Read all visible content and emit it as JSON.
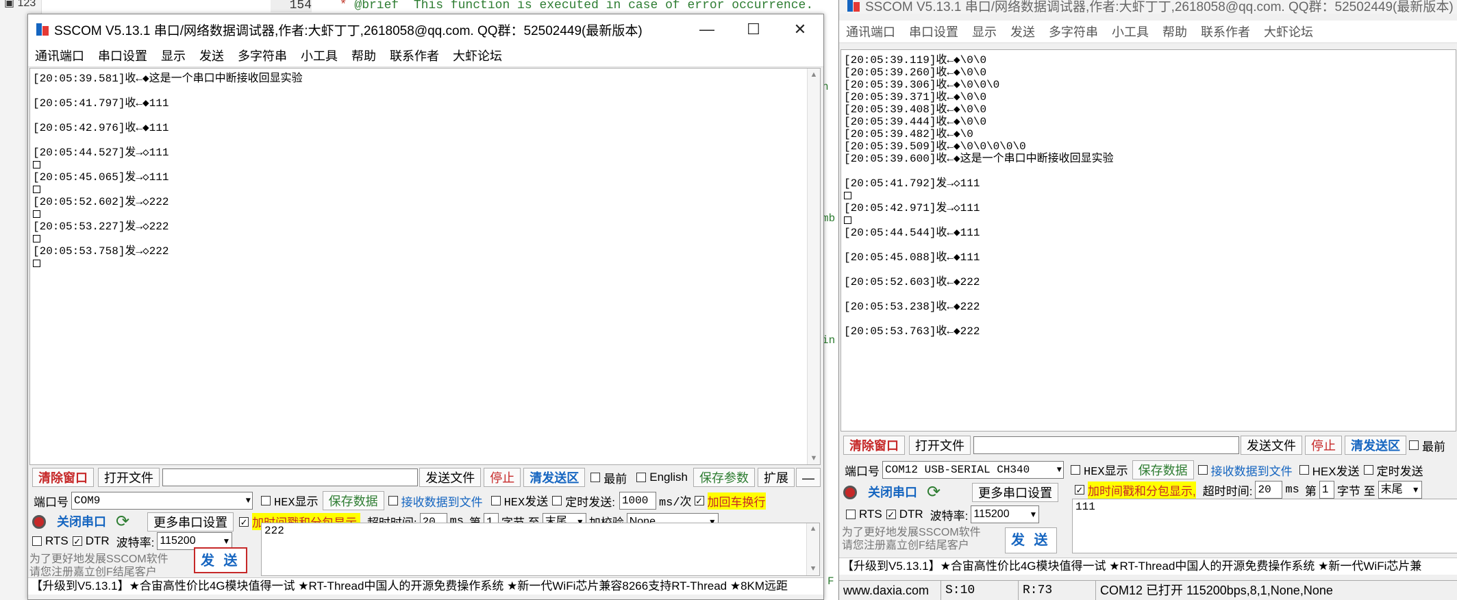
{
  "editor": {
    "tree_label": "123",
    "line_number": "154",
    "code_prefix": " * ",
    "code_tag": "@brief",
    "code_text": "  This function is executed in case of error occurrence.",
    "frag1": "n",
    "frag2": "mb",
    "frag3": "in",
    "frag4": "F"
  },
  "app": {
    "title": "SSCOM V5.13.1 串口/网络数据调试器,作者:大虾丁丁,2618058@qq.com. QQ群：52502449(最新版本)",
    "menus": [
      "通讯端口",
      "串口设置",
      "显示",
      "发送",
      "多字符串",
      "小工具",
      "帮助",
      "联系作者",
      "大虾论坛"
    ],
    "win_controls": {
      "minimize": "—",
      "maximize": "☐",
      "close": "✕"
    }
  },
  "left": {
    "recv": [
      {
        "text": "[20:05:39.581]收←◆这是一个串口中断接收回显实验",
        "box": false
      },
      {
        "text": "[20:05:41.797]收←◆111",
        "box": false
      },
      {
        "text": "[20:05:42.976]收←◆111",
        "box": false
      },
      {
        "text": "[20:05:44.527]发→◇111",
        "box": true
      },
      {
        "text": "[20:05:45.065]发→◇111",
        "box": true
      },
      {
        "text": "[20:05:52.602]发→◇222",
        "box": true
      },
      {
        "text": "[20:05:53.227]发→◇222",
        "box": true
      },
      {
        "text": "[20:05:53.758]发→◇222",
        "box": true
      }
    ],
    "toolbar": {
      "clear_window": "清除窗口",
      "open_file": "打开文件",
      "send_file": "发送文件",
      "stop": "停止",
      "clear_send": "清发送区",
      "topmost": "最前",
      "english": "English",
      "save_params": "保存参数",
      "expand": "扩展",
      "collapse": "—"
    },
    "port_label": "端口号",
    "port_value": "COM9",
    "hex_display": "HEX显示",
    "save_data": "保存数据",
    "recv_to_file": "接收数据到文件",
    "hex_send": "HEX发送",
    "timed_send": "定时发送:",
    "timed_value": "1000",
    "timed_unit": "ms/次",
    "add_crlf": "加回车换行",
    "close_port": "关闭串口",
    "more_settings": "更多串口设置",
    "timestamp_label": "加时间戳和分包显示,",
    "timeout_label": "超时时间:",
    "timeout_value": "20",
    "ms": "ms",
    "di": "第",
    "byte_from": "1",
    "byte_label": "字节 至",
    "byte_to": "末尾",
    "checksum_label": "加校验",
    "checksum_value": "None",
    "rts": "RTS",
    "dtr": "DTR",
    "baud_label": "波特率:",
    "baud_value": "115200",
    "send_text": "222",
    "promo1": "为了更好地发展SSCOM软件",
    "promo2": "请您注册嘉立创F结尾客户",
    "send_button": "发 送",
    "ticker": "【升级到V5.13.1】★合宙高性价比4G模块值得一试 ★RT-Thread中国人的开源免费操作系统 ★新一代WiFi芯片兼容8266支持RT-Thread ★8KM远距"
  },
  "right": {
    "recv": [
      {
        "text": "[20:05:39.119]收←◆\\0\\0",
        "gap": false
      },
      {
        "text": "[20:05:39.260]收←◆\\0\\0",
        "gap": false
      },
      {
        "text": "[20:05:39.306]收←◆\\0\\0\\0",
        "gap": false
      },
      {
        "text": "[20:05:39.371]收←◆\\0\\0",
        "gap": false
      },
      {
        "text": "[20:05:39.408]收←◆\\0\\0",
        "gap": false
      },
      {
        "text": "[20:05:39.444]收←◆\\0\\0",
        "gap": false
      },
      {
        "text": "[20:05:39.482]收←◆\\0",
        "gap": false
      },
      {
        "text": "[20:05:39.509]收←◆\\0\\0\\0\\0\\0",
        "gap": false
      },
      {
        "text": "[20:05:39.600]收←◆这是一个串口中断接收回显实验",
        "gap": false
      },
      {
        "text": "[20:05:41.792]发→◇111",
        "gap": true,
        "box": true
      },
      {
        "text": "[20:05:42.971]发→◇111",
        "gap": false,
        "box": true
      },
      {
        "text": "[20:05:44.544]收←◆111",
        "gap": false
      },
      {
        "text": "[20:05:45.088]收←◆111",
        "gap": true
      },
      {
        "text": "[20:05:52.603]收←◆222",
        "gap": true
      },
      {
        "text": "[20:05:53.238]收←◆222",
        "gap": true
      },
      {
        "text": "[20:05:53.763]收←◆222",
        "gap": true
      }
    ],
    "toolbar": {
      "clear_window": "清除窗口",
      "open_file": "打开文件",
      "send_file": "发送文件",
      "stop": "停止",
      "clear_send": "清发送区",
      "topmost": "最前"
    },
    "port_label": "端口号",
    "port_value": "COM12 USB-SERIAL CH340",
    "hex_display": "HEX显示",
    "save_data": "保存数据",
    "recv_to_file": "接收数据到文件",
    "hex_send": "HEX发送",
    "timed_send": "定时发送",
    "close_port": "关闭串口",
    "more_settings": "更多串口设置",
    "timestamp_label": "加时间戳和分包显示,",
    "timeout_label": "超时时间:",
    "timeout_value": "20",
    "ms": "ms",
    "di": "第",
    "byte_from": "1",
    "byte_label": "字节 至",
    "byte_to": "末尾",
    "rts": "RTS",
    "dtr": "DTR",
    "baud_label": "波特率:",
    "baud_value": "115200",
    "send_text": "111",
    "promo1": "为了更好地发展SSCOM软件",
    "promo2": "请您注册嘉立创F结尾客户",
    "send_button": "发 送",
    "ticker": "【升级到V5.13.1】★合宙高性价比4G模块值得一试 ★RT-Thread中国人的开源免费操作系统 ★新一代WiFi芯片兼",
    "status": {
      "site": "www.daxia.com",
      "sent": "S:10",
      "received": "R:73",
      "port_state": "COM12 已打开  115200bps,8,1,None,None"
    }
  }
}
